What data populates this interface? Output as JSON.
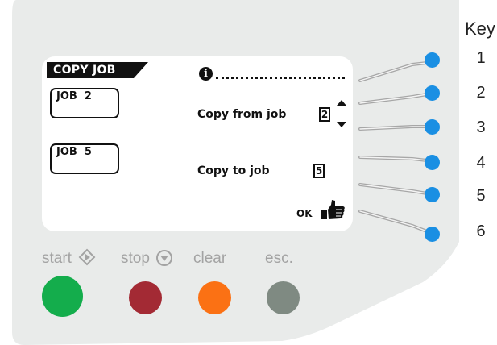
{
  "screen": {
    "title": "COPY JOB",
    "job_boxes": [
      {
        "label": "JOB  2"
      },
      {
        "label": "JOB  5"
      }
    ],
    "copy_from": {
      "label": "Copy from job",
      "value": "2"
    },
    "copy_to": {
      "label": "Copy to job",
      "value": "5"
    },
    "ok_label": "OK"
  },
  "key": {
    "title": "Key",
    "items": [
      "1",
      "2",
      "3",
      "4",
      "5",
      "6"
    ]
  },
  "buttons": {
    "start": {
      "label": "start",
      "color": "#14ad4c"
    },
    "stop": {
      "label": "stop",
      "color": "#a32a34"
    },
    "clear": {
      "label": "clear",
      "color": "#fb7114"
    },
    "esc": {
      "label": "esc.",
      "color": "#7f8a82"
    }
  },
  "colors": {
    "panel": "#e9ebea",
    "screen_border": "#222222",
    "softkey": "#1a8fe3",
    "lines": "#a7a7a7"
  }
}
